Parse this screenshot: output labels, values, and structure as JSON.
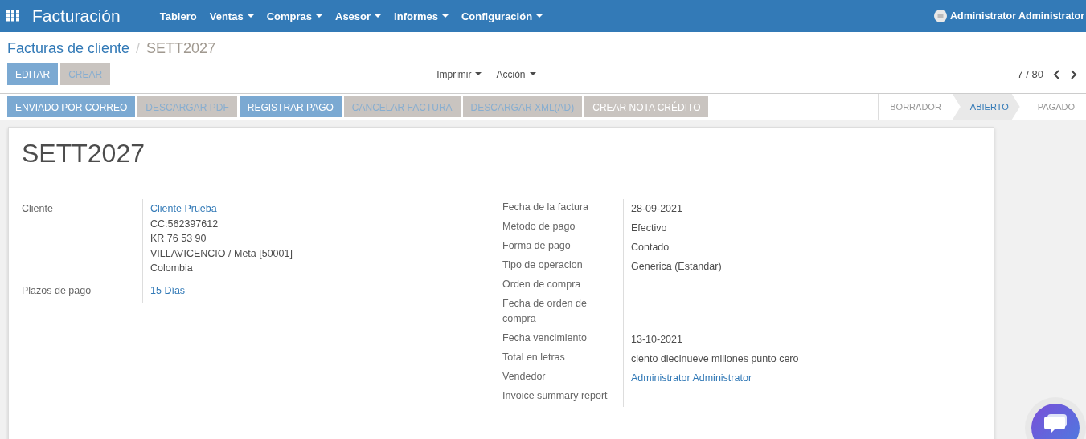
{
  "navbar": {
    "app_title": "Facturación",
    "menu": [
      {
        "label": "Tablero",
        "dropdown": false
      },
      {
        "label": "Ventas",
        "dropdown": true
      },
      {
        "label": "Compras",
        "dropdown": true
      },
      {
        "label": "Asesor",
        "dropdown": true
      },
      {
        "label": "Informes",
        "dropdown": true
      },
      {
        "label": "Configuración",
        "dropdown": true
      }
    ],
    "user": "Administrator Administrator"
  },
  "breadcrumb": {
    "parent": "Facturas de cliente",
    "separator": "/",
    "current": "SETT2027"
  },
  "control_buttons": [
    {
      "label": "EDITAR",
      "kind": "primary"
    },
    {
      "label": "CREAR",
      "kind": "secondary"
    }
  ],
  "actions": [
    {
      "label": "Imprimir"
    },
    {
      "label": "Acción"
    }
  ],
  "pager": "7 / 80",
  "header_buttons": [
    {
      "label": "ENVIADO POR CORREO",
      "kind": "primary"
    },
    {
      "label": "DESCARGAR PDF",
      "kind": "secondary"
    },
    {
      "label": "REGISTRAR PAGO",
      "kind": "primary"
    },
    {
      "label": "CANCELAR FACTURA",
      "kind": "secondary"
    },
    {
      "label": "DESCARGAR XML(AD)",
      "kind": "secondary"
    },
    {
      "label": "CREAR NOTA CRÉDITO",
      "kind": "muted"
    }
  ],
  "statusbar": [
    {
      "label": "BORRADOR",
      "selected": false
    },
    {
      "label": "ABIERTO",
      "selected": true
    },
    {
      "label": "PAGADO",
      "selected": false
    }
  ],
  "sheet": {
    "title": "SETT2027",
    "left_fields": [
      {
        "label": "Cliente",
        "lines": [
          {
            "text": "Cliente Prueba",
            "link": true
          },
          {
            "text": "CC:562397612",
            "link": false
          },
          {
            "text": "KR 76 53 90",
            "link": false
          },
          {
            "text": "VILLAVICENCIO / Meta [50001]",
            "link": false
          },
          {
            "text": "Colombia",
            "link": false
          }
        ]
      },
      {
        "label": "Plazos de pago",
        "lines": [
          {
            "text": "15 Días",
            "link": true
          }
        ]
      }
    ],
    "right_fields": [
      {
        "label": "Fecha de la factura",
        "value": "28-09-2021",
        "link": false
      },
      {
        "label": "Metodo de pago",
        "value": "Efectivo",
        "link": false
      },
      {
        "label": "Forma de pago",
        "value": "Contado",
        "link": false
      },
      {
        "label": "Tipo de operacion",
        "value": "Generica (Estandar)",
        "link": false
      },
      {
        "label": "Orden de compra"
      },
      {
        "label": "Fecha de orden de compra"
      },
      {
        "label": "Fecha vencimiento",
        "value": "13-10-2021",
        "link": false
      },
      {
        "label": "Total en letras",
        "value": "ciento diecinueve millones punto cero",
        "link": false
      },
      {
        "label": "Vendedor",
        "value": "Administrator Administrator",
        "link": true
      },
      {
        "label": "Invoice summary report"
      }
    ]
  }
}
